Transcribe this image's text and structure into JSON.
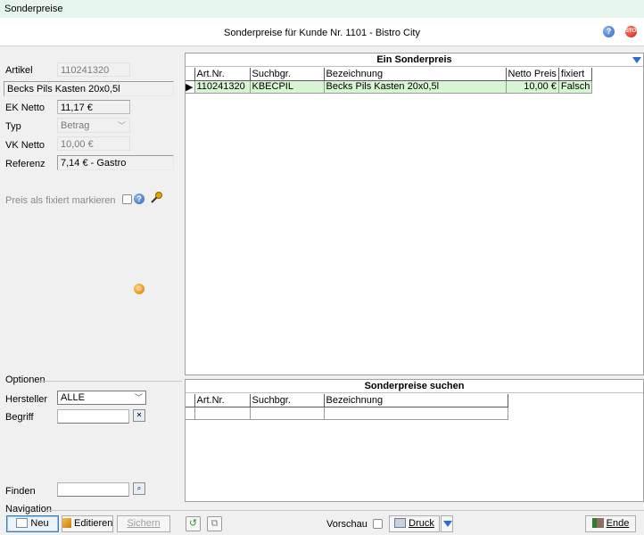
{
  "window": {
    "title": "Sonderpreise"
  },
  "header": {
    "title": "Sonderpreise für Kunde Nr. 1101 - Bistro City"
  },
  "article": {
    "artikel_label": "Artikel",
    "artikel_value": "110241320",
    "name_value": "Becks Pils Kasten 20x0,5l",
    "ek_label": "EK Netto",
    "ek_value": "11,17 €",
    "typ_label": "Typ",
    "typ_value": "Betrag",
    "vk_label": "VK Netto",
    "vk_value": "10,00 €",
    "referenz_label": "Referenz",
    "referenz_value": "7,14 € - Gastro",
    "fixiert_label": "Preis als fixiert markieren"
  },
  "grid_main": {
    "title": "Ein Sonderpreis",
    "columns": [
      "Art.Nr.",
      "Suchbgr.",
      "Bezeichnung",
      "Netto Preis",
      "fixiert"
    ],
    "rows": [
      [
        "110241320",
        "KBECPIL",
        "Becks Pils Kasten 20x0,5l",
        "10,00 €",
        "Falsch"
      ]
    ]
  },
  "grid_search": {
    "title": "Sonderpreise suchen",
    "columns": [
      "Art.Nr.",
      "Suchbgr.",
      "Bezeichnung"
    ]
  },
  "options": {
    "section_label": "Optionen",
    "hersteller_label": "Hersteller",
    "hersteller_value": "ALLE",
    "begriff_label": "Begriff",
    "begriff_value": "",
    "finden_label": "Finden",
    "finden_value": ""
  },
  "navigation": {
    "section_label": "Navigation",
    "neu": "Neu",
    "editieren": "Editieren",
    "sichern": "Sichern",
    "vorschau": "Vorschau",
    "druck": "Druck",
    "ende": "Ende"
  },
  "colors": {
    "selected_row": "#d8f5d3",
    "accent": "#2d6ccf",
    "titlebar": "#e6f5ee"
  }
}
